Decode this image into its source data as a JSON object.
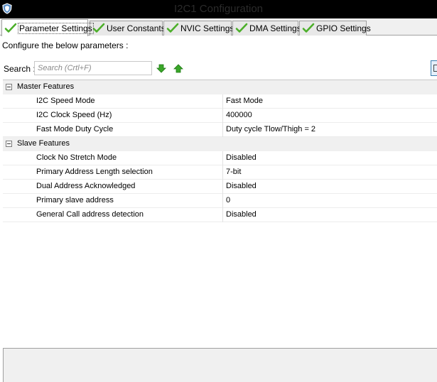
{
  "window": {
    "title": "I2C1 Configuration",
    "icon": "shield-icon"
  },
  "tabs": [
    {
      "label": "Parameter Settings",
      "icon": "green-check-icon",
      "active": true
    },
    {
      "label": "User Constants",
      "icon": "green-check-icon",
      "active": false
    },
    {
      "label": "NVIC Settings",
      "icon": "green-check-icon",
      "active": false
    },
    {
      "label": "DMA Settings",
      "icon": "green-check-icon",
      "active": false
    },
    {
      "label": "GPIO Settings",
      "icon": "green-check-icon",
      "active": false
    }
  ],
  "panel": {
    "instruction": "Configure the below parameters :"
  },
  "search": {
    "label": "Search :",
    "placeholder": "Search (Crtl+F)"
  },
  "groups": [
    {
      "title": "Master Features",
      "expander": "−",
      "properties": [
        {
          "name": "I2C Speed Mode",
          "value": "Fast Mode"
        },
        {
          "name": "I2C Clock Speed (Hz)",
          "value": "400000"
        },
        {
          "name": "Fast Mode Duty Cycle",
          "value": "Duty cycle Tlow/Thigh = 2"
        }
      ]
    },
    {
      "title": "Slave Features",
      "expander": "−",
      "properties": [
        {
          "name": "Clock No Stretch Mode",
          "value": "Disabled"
        },
        {
          "name": "Primary Address Length selection",
          "value": "7-bit"
        },
        {
          "name": "Dual Address Acknowledged",
          "value": "Disabled"
        },
        {
          "name": "Primary slave address",
          "value": "0"
        },
        {
          "name": "General Call address detection",
          "value": "Disabled"
        }
      ]
    }
  ],
  "colors": {
    "check_green": "#4caf2a",
    "arrow_green": "#3aa629",
    "titlebar": "#000000",
    "group_row": "#f0f0f0"
  }
}
